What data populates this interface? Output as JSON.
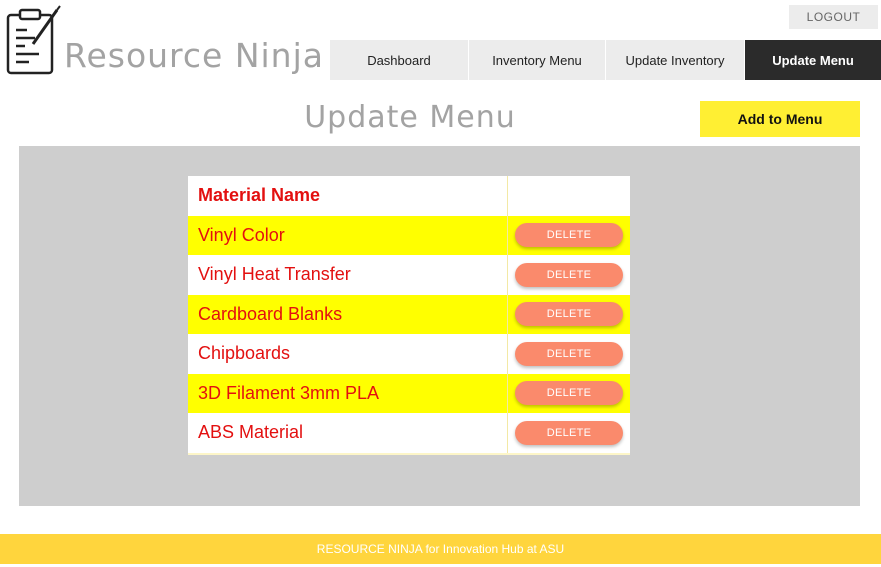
{
  "app": {
    "brand": "Resource Ninja",
    "logout_label": "LOGOUT"
  },
  "nav": {
    "tabs": [
      {
        "label": "Dashboard",
        "active": false
      },
      {
        "label": "Inventory Menu",
        "active": false
      },
      {
        "label": "Update Inventory",
        "active": false
      },
      {
        "label": "Update Menu",
        "active": true
      }
    ]
  },
  "page": {
    "title": "Update Menu",
    "add_label": "Add to Menu"
  },
  "table": {
    "header": {
      "name": "Material Name",
      "action": ""
    },
    "delete_label": "DELETE",
    "rows": [
      {
        "name": "Vinyl Color"
      },
      {
        "name": "Vinyl Heat Transfer"
      },
      {
        "name": "Cardboard Blanks"
      },
      {
        "name": "Chipboards"
      },
      {
        "name": "3D Filament 3mm PLA"
      },
      {
        "name": "ABS Material"
      }
    ]
  },
  "footer": {
    "text": "RESOURCE NINJA for Innovation Hub at ASU"
  },
  "colors": {
    "accent_yellow": "#ffff00",
    "button_yellow": "#ffef33",
    "delete_orange": "#fa8a6c",
    "footer_yellow": "#ffd53d",
    "text_red": "#e31010",
    "nav_active": "#2b2b2b"
  },
  "icons": {
    "logo": "clipboard-pen-icon"
  }
}
